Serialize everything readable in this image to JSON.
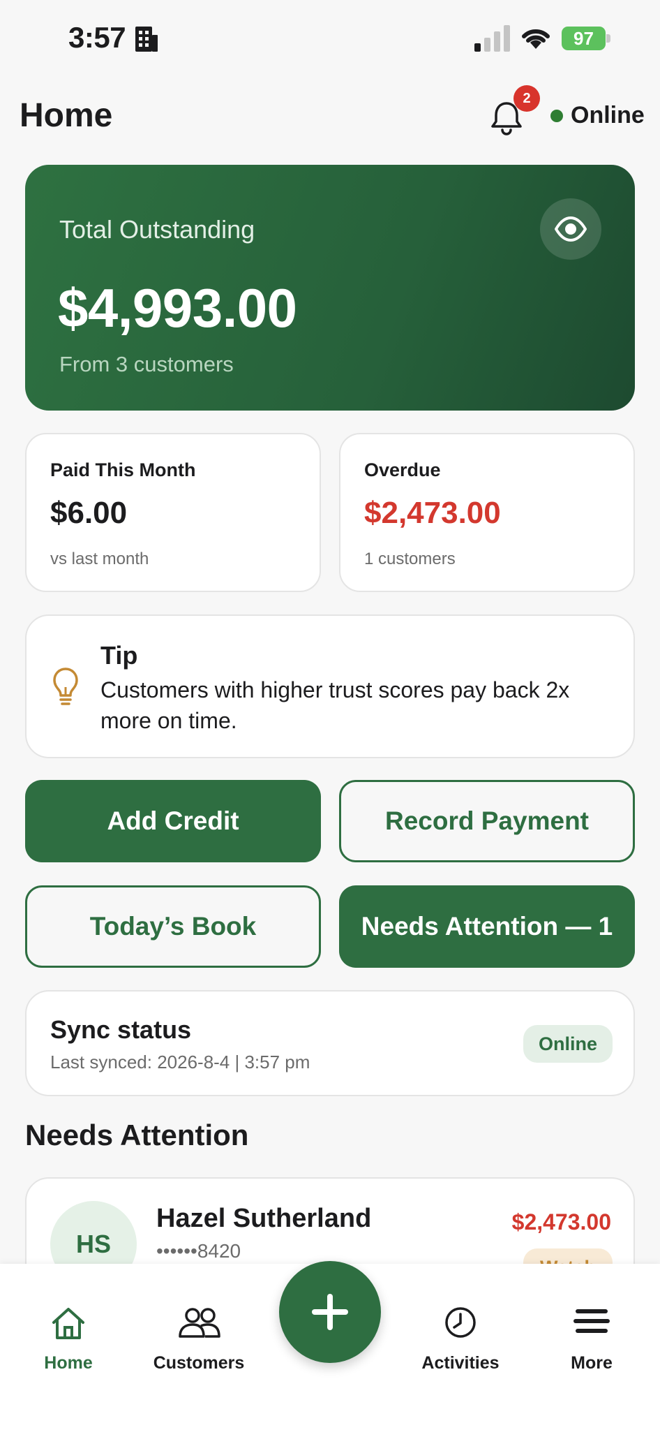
{
  "status_bar": {
    "time": "3:57",
    "battery": "97"
  },
  "header": {
    "title": "Home",
    "notification_count": "2",
    "connection_label": "Online"
  },
  "summary": {
    "label": "Total Outstanding",
    "amount": "$4,993.00",
    "subtitle": "From 3 customers"
  },
  "stats": {
    "paid": {
      "title": "Paid This Month",
      "value": "$6.00",
      "sub": "vs last month"
    },
    "overdue": {
      "title": "Overdue",
      "value": "$2,473.00",
      "sub": "1 customers"
    }
  },
  "tip": {
    "title": "Tip",
    "text": "Customers with higher trust scores pay back 2x more on time."
  },
  "actions": {
    "add_credit": "Add Credit",
    "record_payment": "Record Payment",
    "todays_book": "Today’s Book",
    "needs_attention": "Needs Attention — 1"
  },
  "sync": {
    "title": "Sync status",
    "last_synced": "Last synced: 2026-8-4 | 3:57 pm",
    "status": "Online"
  },
  "needs_attention": {
    "title": "Needs Attention",
    "items": [
      {
        "initials": "HS",
        "name": "Hazel Sutherland",
        "phone": "••••••8420",
        "amount": "$2,473.00",
        "tag": "Watch"
      }
    ]
  },
  "nav": {
    "home": "Home",
    "customers": "Customers",
    "activities": "Activities",
    "more": "More"
  },
  "colors": {
    "primary": "#2e6e41",
    "danger": "#d3382e",
    "warning": "#c48a34",
    "background": "#f7f7f7"
  },
  "icons": [
    "building-icon",
    "signal-icon",
    "wifi-icon",
    "battery-icon",
    "bell-icon",
    "eye-icon",
    "lightbulb-icon",
    "home-icon",
    "customers-icon",
    "plus-icon",
    "clock-icon",
    "menu-icon"
  ]
}
